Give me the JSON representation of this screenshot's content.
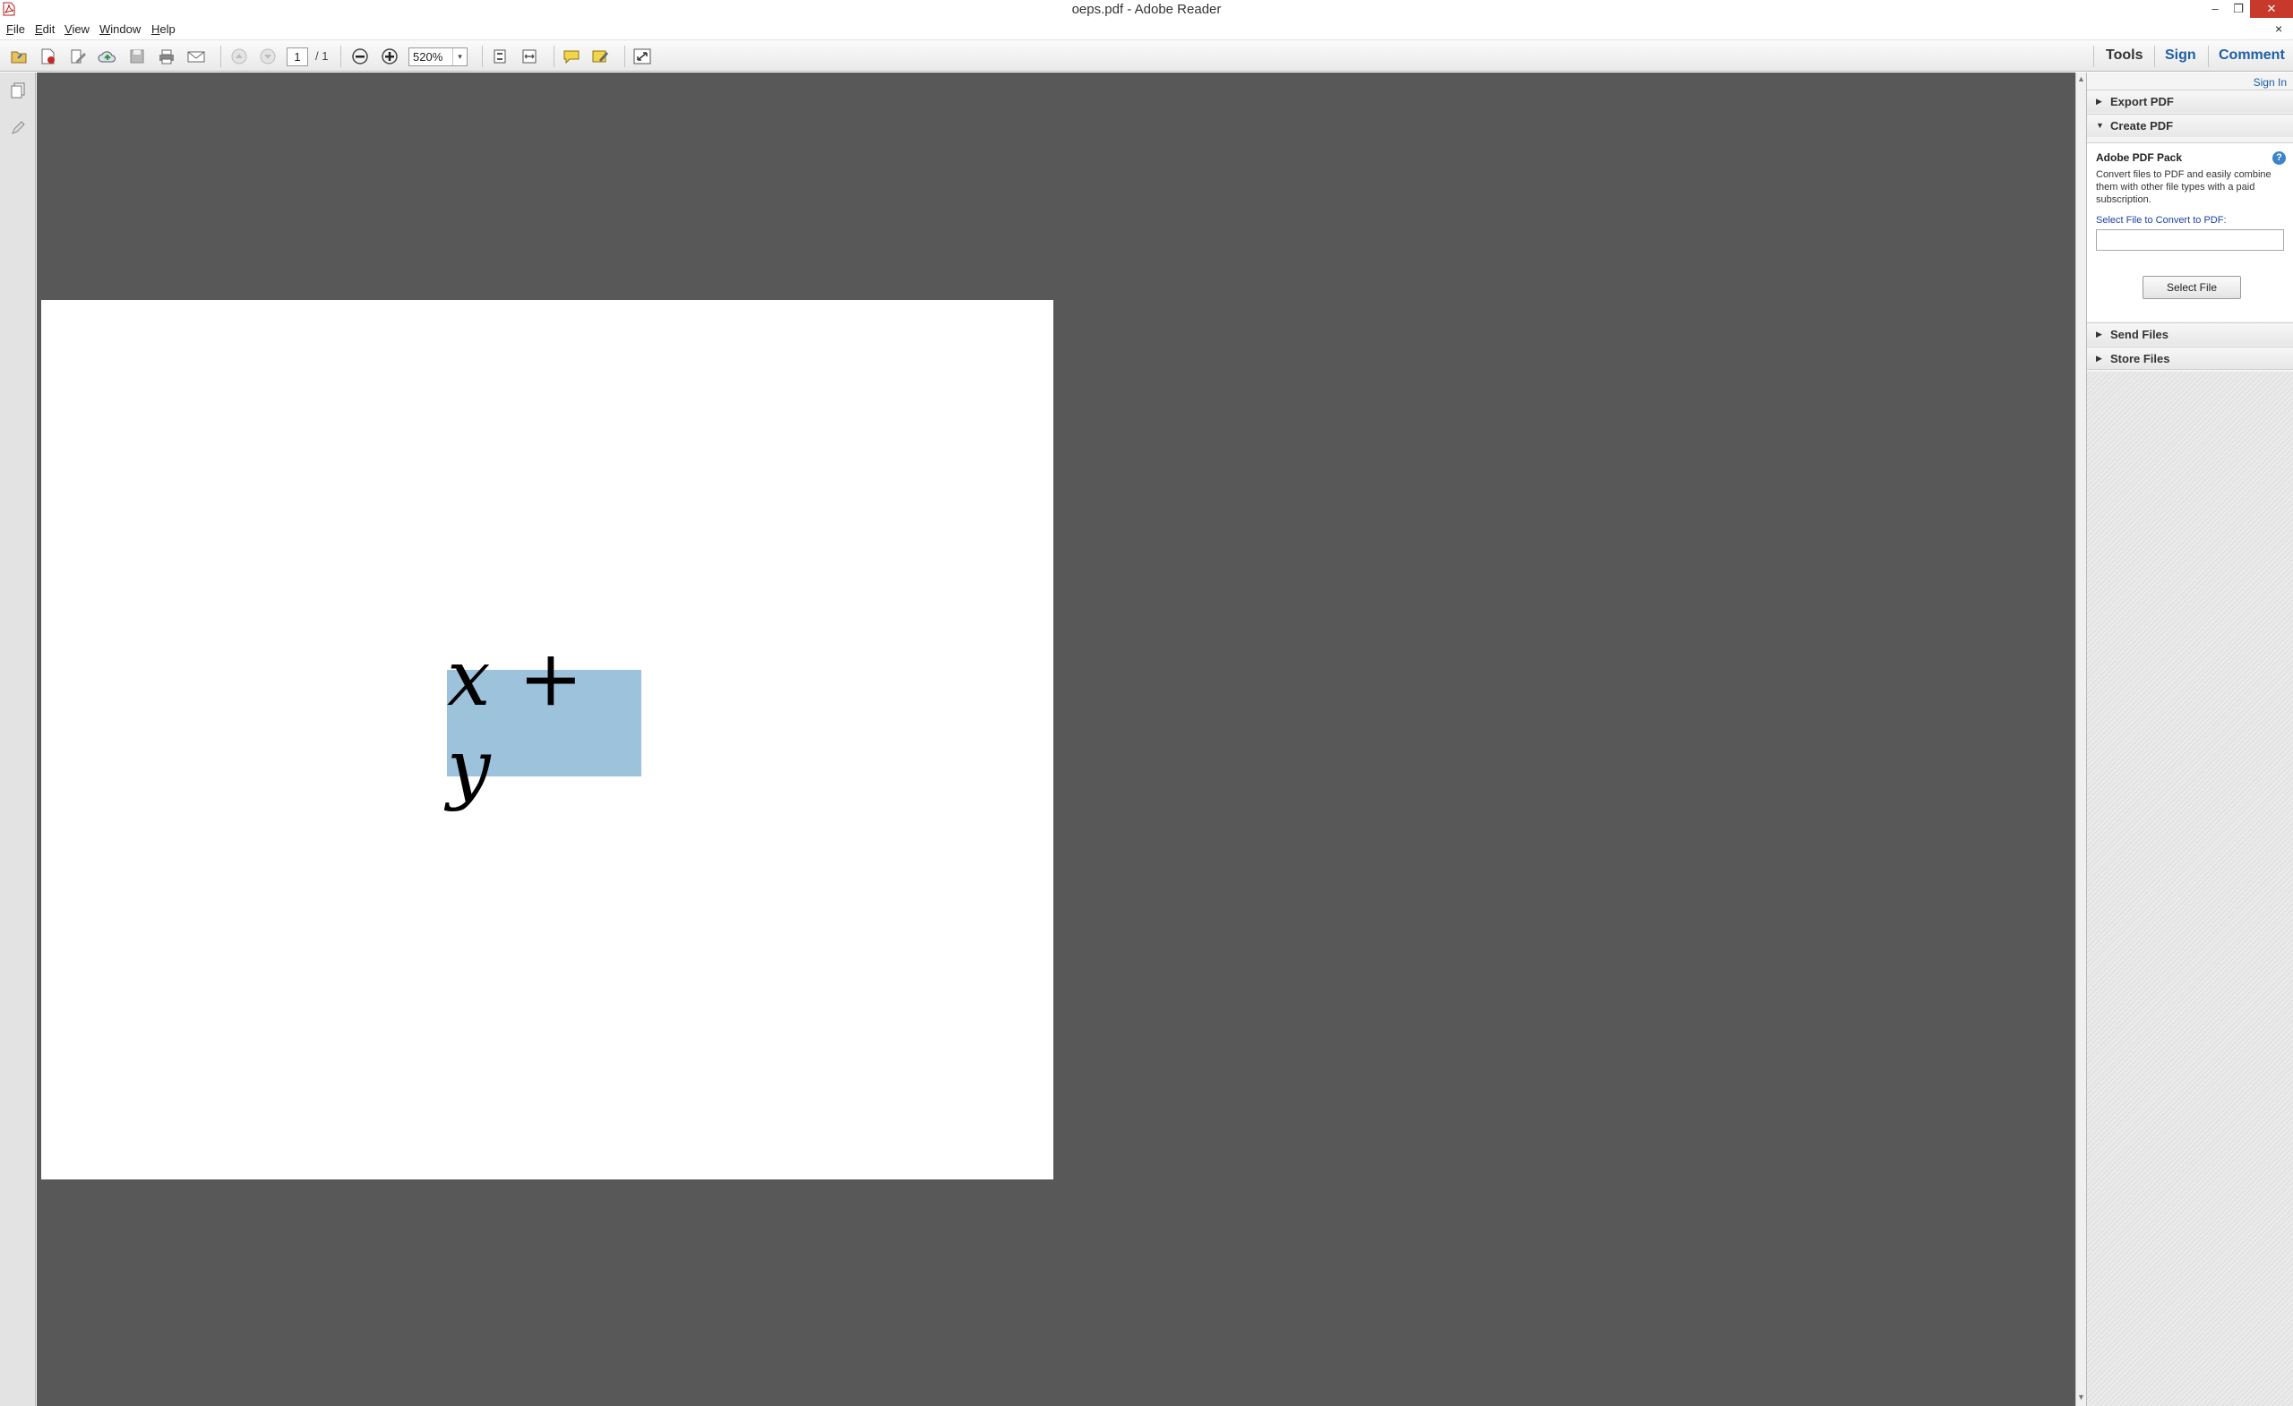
{
  "window": {
    "title": "oeps.pdf - Adobe Reader",
    "min_glyph": "–",
    "max_glyph": "❐",
    "close_glyph": "✕",
    "doc_close_glyph": "×"
  },
  "menu": {
    "items": [
      {
        "label": "File",
        "accel": "F",
        "rest": "ile"
      },
      {
        "label": "Edit",
        "accel": "E",
        "rest": "dit"
      },
      {
        "label": "View",
        "accel": "V",
        "rest": "iew"
      },
      {
        "label": "Window",
        "accel": "W",
        "rest": "indow"
      },
      {
        "label": "Help",
        "accel": "H",
        "rest": "elp"
      }
    ]
  },
  "toolbar": {
    "icons": [
      "open-icon",
      "create-pdf-icon",
      "edit-icon",
      "cloud-upload-icon",
      "save-icon",
      "print-icon",
      "email-icon",
      "previous-page-icon",
      "next-page-icon",
      "zoom-out-icon",
      "zoom-in-icon",
      "fit-page-icon",
      "fit-width-icon",
      "comment-icon",
      "highlight-icon",
      "read-mode-icon"
    ],
    "page_current": "1",
    "page_total": "/ 1",
    "zoom_value": "520%",
    "zoom_drop_glyph": "▾",
    "tab_tools": "Tools",
    "tab_sign": "Sign",
    "tab_comment": "Comment"
  },
  "document": {
    "formula": "x + y",
    "highlight_color": "#9dc2dc",
    "background_color": "#585858"
  },
  "scrollbar": {
    "up_glyph": "▲",
    "down_glyph": "▼"
  },
  "right_pane": {
    "sign_in": "Sign In",
    "export_pdf": "Export PDF",
    "create_pdf": "Create PDF",
    "pack_title": "Adobe PDF Pack",
    "help_glyph": "?",
    "pack_description": "Convert files to PDF and easily combine them with other file types with a paid subscription.",
    "select_label": "Select File to Convert to PDF:",
    "select_button": "Select File",
    "send_files": "Send Files",
    "store_files": "Store Files",
    "collapsed_glyph": "▶",
    "expanded_glyph": "▼"
  },
  "colors": {
    "accent_blue": "#1d5fa8",
    "close_red": "#c7392b"
  }
}
